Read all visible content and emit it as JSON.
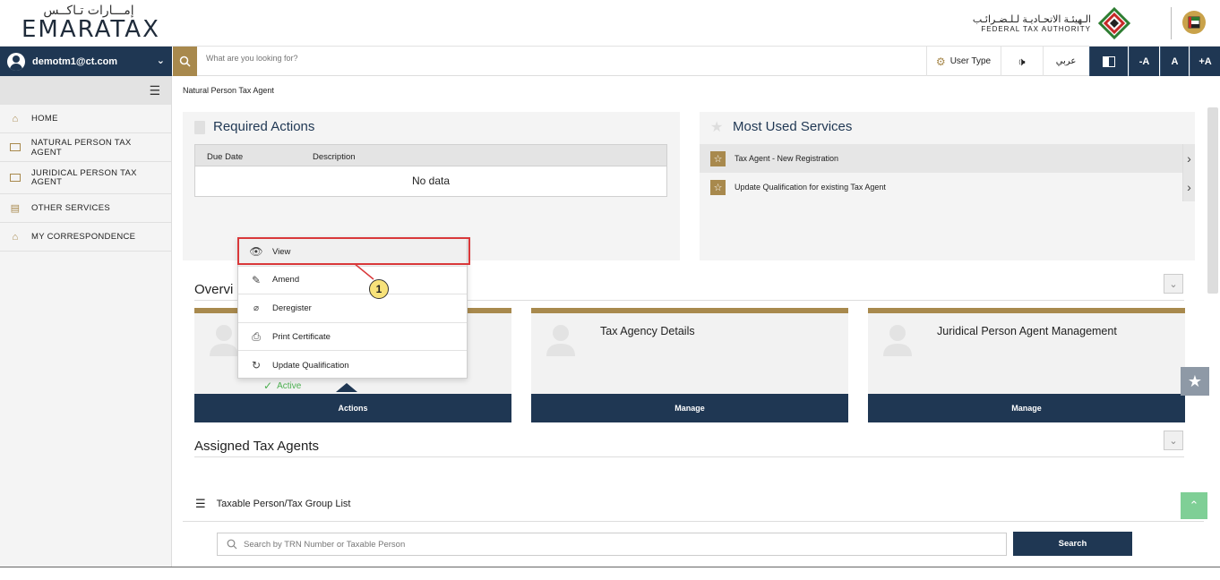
{
  "header": {
    "logo_ar": "إمـــارات تـاكــس",
    "logo_en": "EMARATAX",
    "fta_ar": "الـهيئـة الاتحـاديـة لـلـضـرائـب",
    "fta_en": "FEDERAL TAX AUTHORITY"
  },
  "toolbar": {
    "user_email": "demotm1@ct.com",
    "search_placeholder": "What are you looking for?",
    "user_type_label": "User Type",
    "arabic_label": "عربي",
    "font_minus": "-A",
    "font_normal": "A",
    "font_plus": "+A"
  },
  "sidebar": {
    "items": [
      {
        "label": "HOME",
        "icon": "home-icon"
      },
      {
        "label": "NATURAL PERSON TAX AGENT",
        "icon": "id-card-icon"
      },
      {
        "label": "JURIDICAL PERSON TAX AGENT",
        "icon": "id-card-icon"
      },
      {
        "label": "OTHER SERVICES",
        "icon": "document-icon"
      },
      {
        "label": "MY CORRESPONDENCE",
        "icon": "building-icon"
      }
    ]
  },
  "breadcrumb": "Natural Person Tax Agent",
  "required_actions": {
    "title": "Required Actions",
    "col_due_date": "Due Date",
    "col_description": "Description",
    "empty_text": "No data"
  },
  "most_used": {
    "title": "Most Used Services",
    "items": [
      "Tax Agent - New Registration",
      "Update Qualification for existing Tax Agent"
    ]
  },
  "overview": {
    "title_visible": "Overvi",
    "cards": [
      {
        "title": "",
        "button": "Actions",
        "status": "Active"
      },
      {
        "title": "Tax Agency Details",
        "button": "Manage"
      },
      {
        "title": "Juridical Person Agent Management",
        "button": "Manage"
      }
    ]
  },
  "actions_menu": {
    "items": [
      {
        "label": "View",
        "icon": "eye-icon"
      },
      {
        "label": "Amend",
        "icon": "edit-icon"
      },
      {
        "label": "Deregister",
        "icon": "deregister-icon"
      },
      {
        "label": "Print Certificate",
        "icon": "printer-icon"
      },
      {
        "label": "Update Qualification",
        "icon": "refresh-icon"
      }
    ],
    "callout_number": "1"
  },
  "assigned": {
    "title": "Assigned Tax Agents",
    "list_title": "Taxable Person/Tax Group List",
    "search_placeholder": "Search by TRN Number or Taxable Person",
    "search_button": "Search"
  },
  "colors": {
    "navy": "#1f3753",
    "gold": "#a8894d",
    "highlight_red": "#d9383a",
    "active_green": "#4caf50"
  }
}
